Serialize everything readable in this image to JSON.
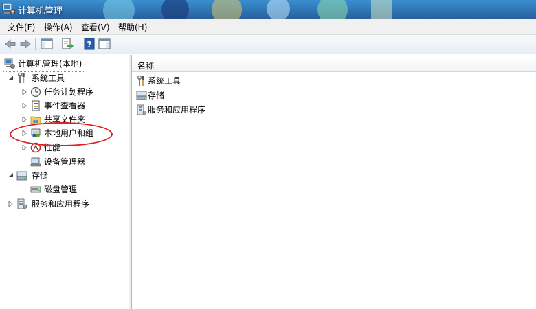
{
  "window": {
    "title": "计算机管理"
  },
  "menu": [
    {
      "label": "文件(F)"
    },
    {
      "label": "操作(A)"
    },
    {
      "label": "查看(V)"
    },
    {
      "label": "帮助(H)"
    }
  ],
  "toolbar": {
    "buttons": [
      "back-icon",
      "forward-icon",
      "show-hide-tree-icon",
      "export-list-icon",
      "help-icon",
      "show-hide-action-pane-icon"
    ]
  },
  "tree": {
    "root": "计算机管理(本地)",
    "system_tools": "系统工具",
    "task_scheduler": "任务计划程序",
    "event_viewer": "事件查看器",
    "shared_folders": "共享文件夹",
    "local_users_groups": "本地用户和组",
    "performance": "性能",
    "device_manager": "设备管理器",
    "storage": "存储",
    "disk_management": "磁盘管理",
    "services_apps": "服务和应用程序"
  },
  "list": {
    "column_name": "名称",
    "items": [
      "系统工具",
      "存储",
      "服务和应用程序"
    ]
  },
  "colors": {
    "annotation": "#e02020",
    "titlebar": "#2f74b4"
  }
}
